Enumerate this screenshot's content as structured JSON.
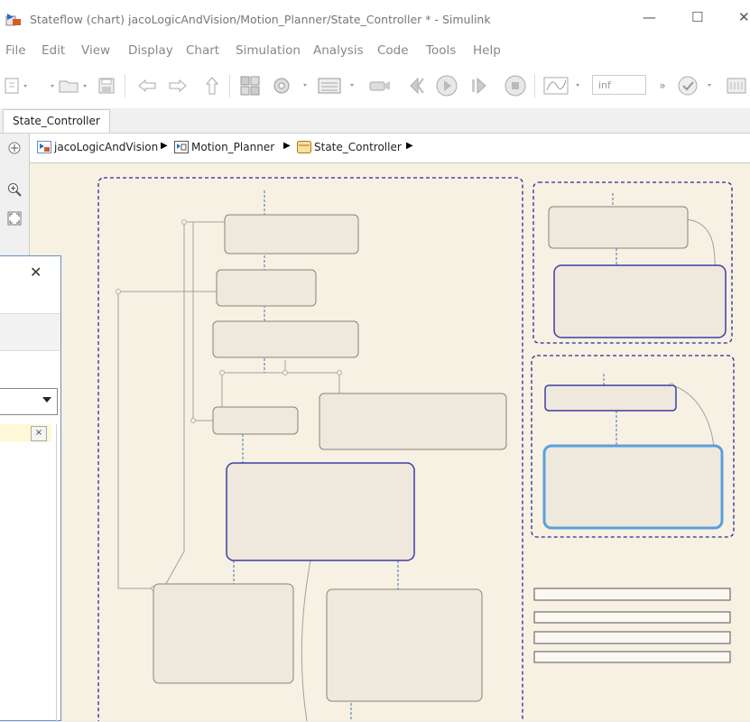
{
  "window": {
    "title": "Stateflow (chart) jacoLogicAndVision/Motion_Planner/State_Controller * - Simulink",
    "minimize_glyph": "—",
    "maximize_glyph": "☐",
    "close_glyph": "✕"
  },
  "menu": {
    "items": [
      "File",
      "Edit",
      "View",
      "Display",
      "Chart",
      "Simulation",
      "Analysis",
      "Code",
      "Tools",
      "Help"
    ]
  },
  "toolbar": {
    "stop_time": "inf",
    "more_glyph": "»",
    "icons": [
      "new-model-icon",
      "open-icon",
      "save-icon",
      "back-arrow-icon",
      "forward-arrow-icon",
      "up-arrow-icon",
      "library-browser-icon",
      "model-settings-icon",
      "model-explorer-icon",
      "record-icon",
      "step-back-icon",
      "run-icon",
      "step-forward-icon",
      "stop-icon",
      "data-inspector-icon",
      "check-icon",
      "build-icon"
    ]
  },
  "tabs": [
    {
      "label": "State_Controller"
    }
  ],
  "breadcrumb": [
    {
      "label": "jacoLogicAndVision",
      "icon": "model-icon"
    },
    {
      "label": "Motion_Planner",
      "icon": "subsystem-icon"
    },
    {
      "label": "State_Controller",
      "icon": "chart-icon"
    }
  ],
  "palette": {
    "icons": [
      "hide-explorer-icon",
      "zoom-in-icon",
      "fit-view-icon"
    ]
  },
  "dialog": {
    "close_glyph": "✕",
    "filter_clear_glyph": "×"
  },
  "colors": {
    "canvas": "#f7f1e4",
    "state_fill": "#efe8dc",
    "state_border": "#8a8478",
    "active_state_border": "#3d3da8",
    "selected_state_border": "#5aa0dc",
    "subchart_outline": "#2a2a90"
  }
}
